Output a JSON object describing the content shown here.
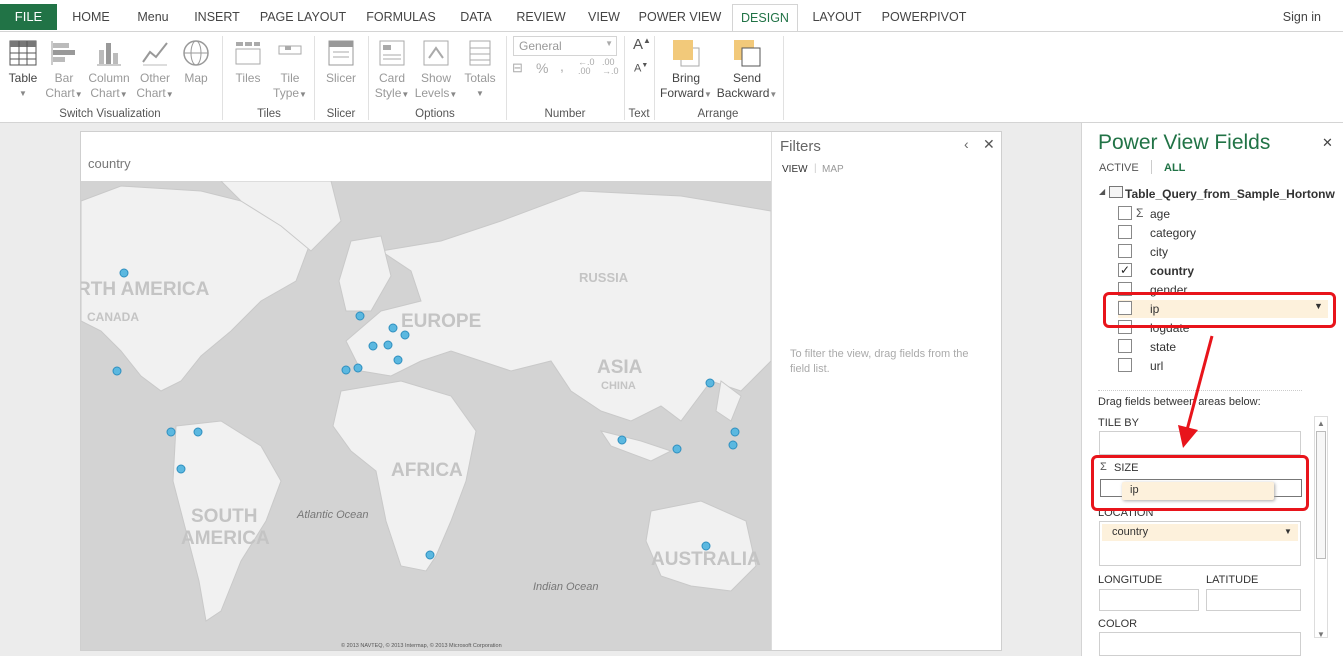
{
  "tabs": {
    "file": "FILE",
    "items": [
      "HOME",
      "Menu",
      "INSERT",
      "PAGE LAYOUT",
      "FORMULAS",
      "DATA",
      "REVIEW",
      "VIEW",
      "POWER VIEW",
      "DESIGN",
      "LAYOUT",
      "POWERPIVOT"
    ],
    "active": "DESIGN",
    "signin": "Sign in"
  },
  "ribbon": {
    "switch_viz": {
      "table": "Table",
      "bar": [
        "Bar",
        "Chart"
      ],
      "column": [
        "Column",
        "Chart"
      ],
      "other": [
        "Other",
        "Chart"
      ],
      "map": "Map",
      "label": "Switch Visualization"
    },
    "tiles": {
      "tiles": "Tiles",
      "tile_type": [
        "Tile",
        "Type"
      ],
      "label": "Tiles"
    },
    "slicer": {
      "slicer": "Slicer",
      "label": "Slicer"
    },
    "options": {
      "card_style": [
        "Card",
        "Style"
      ],
      "show_levels": [
        "Show",
        "Levels"
      ],
      "totals": "Totals",
      "label": "Options"
    },
    "number": {
      "format": "General",
      "label": "Number"
    },
    "text": {
      "label": "Text"
    },
    "arrange": {
      "bring_forward": [
        "Bring",
        "Forward"
      ],
      "send_backward": [
        "Send",
        "Backward"
      ],
      "label": "Arrange"
    }
  },
  "map_card": {
    "title": "country",
    "labels": {
      "north_america": "RTH AMERICA",
      "canada": "CANADA",
      "europe": "EUROPE",
      "russia": "RUSSIA",
      "asia": "ASIA",
      "china": "CHINA",
      "africa": "AFRICA",
      "south_america": [
        "SOUTH",
        "AMERICA"
      ],
      "atlantic": "Atlantic Ocean",
      "indian": "Indian Ocean",
      "australia": "AUSTRALIA"
    },
    "copyright": "© 2013 NAVTEQ, © 2013 Intermap, © 2013 Microsoft Corporation",
    "point_count": 20
  },
  "filters": {
    "title": "Filters",
    "view_tab": "VIEW",
    "map_tab": "MAP",
    "hint": "To filter the view, drag fields from the field list."
  },
  "fields_pane": {
    "title": "Power View Fields",
    "active_tab": "ACTIVE",
    "all_tab": "ALL",
    "table_name": "Table_Query_from_Sample_Hortonw",
    "fields": [
      {
        "name": "age",
        "sigma": true,
        "checked": false
      },
      {
        "name": "category",
        "sigma": false,
        "checked": false
      },
      {
        "name": "city",
        "sigma": false,
        "checked": false
      },
      {
        "name": "country",
        "sigma": false,
        "checked": true
      },
      {
        "name": "gender",
        "sigma": false,
        "checked": false
      },
      {
        "name": "ip",
        "sigma": false,
        "checked": false
      },
      {
        "name": "logdate",
        "sigma": false,
        "checked": false
      },
      {
        "name": "state",
        "sigma": false,
        "checked": false
      },
      {
        "name": "url",
        "sigma": false,
        "checked": false
      }
    ],
    "drag_hint": "Drag fields between areas below:",
    "tile_by": "TILE BY",
    "size": "SIZE",
    "size_value": "ip",
    "location": "LOCATION",
    "location_value": "country",
    "longitude": "LONGITUDE",
    "latitude": "LATITUDE",
    "color": "COLOR"
  },
  "colors": {
    "accent": "#217346",
    "highlight": "#e8141b",
    "field_fill": "#fdf1dc",
    "point": "#4fb3dc"
  }
}
